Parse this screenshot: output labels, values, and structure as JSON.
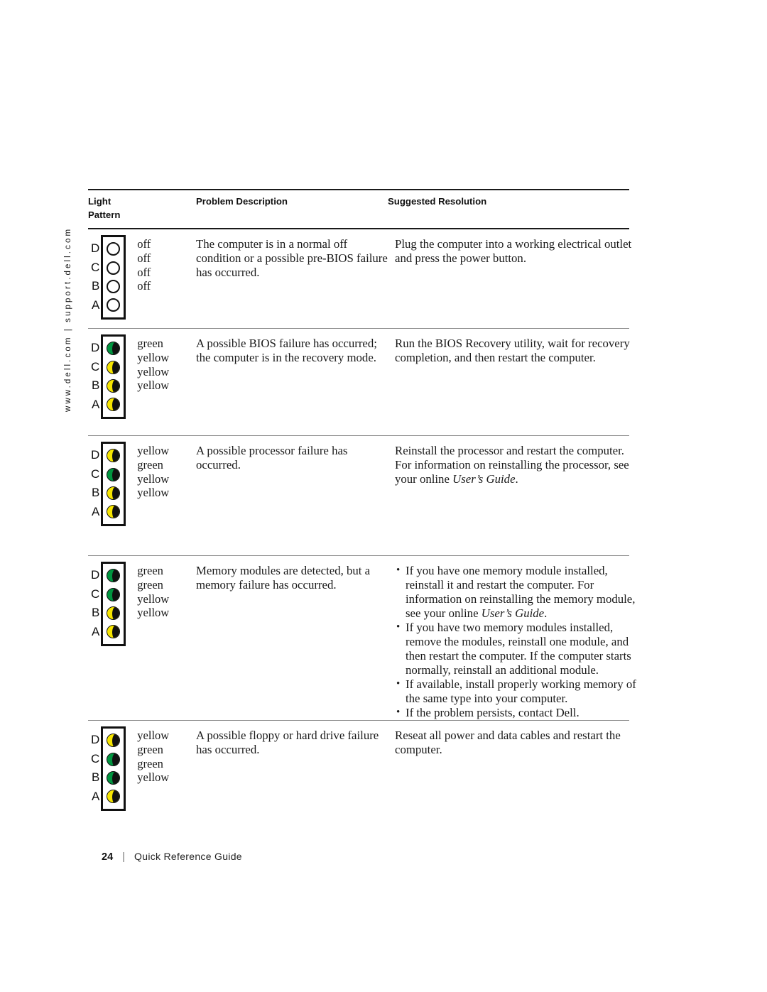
{
  "sidebar": {
    "vertical_text": "www.dell.com | support.dell.com"
  },
  "table": {
    "headers": {
      "light_pattern": "Light\nPattern",
      "light_pattern_line1": "Light",
      "light_pattern_line2": "Pattern",
      "problem_description": "Problem Description",
      "suggested_resolution": "Suggested Resolution"
    },
    "led_labels": [
      "D",
      "C",
      "B",
      "A"
    ],
    "rows": [
      {
        "leds": [
          "off",
          "off",
          "off",
          "off"
        ],
        "states": [
          "off",
          "off",
          "off",
          "off"
        ],
        "problem": "The computer is in a normal off condition or a possible pre-BIOS failure has occurred.",
        "resolution": "Plug the computer into a working electrical outlet and press the power button.",
        "resolution_bullets": []
      },
      {
        "leds": [
          "green",
          "yellow",
          "yellow",
          "yellow"
        ],
        "states": [
          "green",
          "yellow",
          "yellow",
          "yellow"
        ],
        "problem": "A possible BIOS failure has occurred; the computer is in the recovery mode.",
        "resolution": "Run the BIOS Recovery utility, wait for recovery completion, and then restart the computer.",
        "resolution_bullets": []
      },
      {
        "leds": [
          "yellow",
          "green",
          "yellow",
          "yellow"
        ],
        "states": [
          "yellow",
          "green",
          "yellow",
          "yellow"
        ],
        "problem": "A possible processor failure has occurred.",
        "resolution_pre": "Reinstall the processor and restart the computer. For information on reinstalling the processor, see your online ",
        "resolution_italic": "User’s Guide",
        "resolution_post": ".",
        "resolution_bullets": []
      },
      {
        "leds": [
          "green",
          "green",
          "yellow",
          "yellow"
        ],
        "states": [
          "green",
          "green",
          "yellow",
          "yellow"
        ],
        "problem": "Memory modules are detected, but a memory failure has occurred.",
        "resolution_bullets": [
          {
            "pre": "If you have one memory module installed, reinstall it and restart the computer. For information on reinstalling the memory module, see your online ",
            "italic": "User’s Guide",
            "post": "."
          },
          {
            "pre": "If you have two memory modules installed, remove the modules, reinstall one module, and then restart the computer. If the computer starts normally, reinstall an additional module.",
            "italic": "",
            "post": ""
          },
          {
            "pre": "If available, install properly working memory of the same type into your computer.",
            "italic": "",
            "post": ""
          },
          {
            "pre": "If the problem persists, contact Dell.",
            "italic": "",
            "post": ""
          }
        ]
      },
      {
        "leds": [
          "yellow",
          "green",
          "green",
          "yellow"
        ],
        "states": [
          "yellow",
          "green",
          "green",
          "yellow"
        ],
        "problem": "A possible floppy or hard drive failure has occurred.",
        "resolution": "Reseat all power and data cables and restart the computer.",
        "resolution_bullets": []
      }
    ]
  },
  "footer": {
    "page_number": "24",
    "separator": "|",
    "title": "Quick Reference Guide"
  },
  "colors": {
    "led_green": "#00953f",
    "led_yellow": "#f6e500",
    "rule_dark": "#1a1a1a",
    "rule_light": "#8a8a8a"
  }
}
